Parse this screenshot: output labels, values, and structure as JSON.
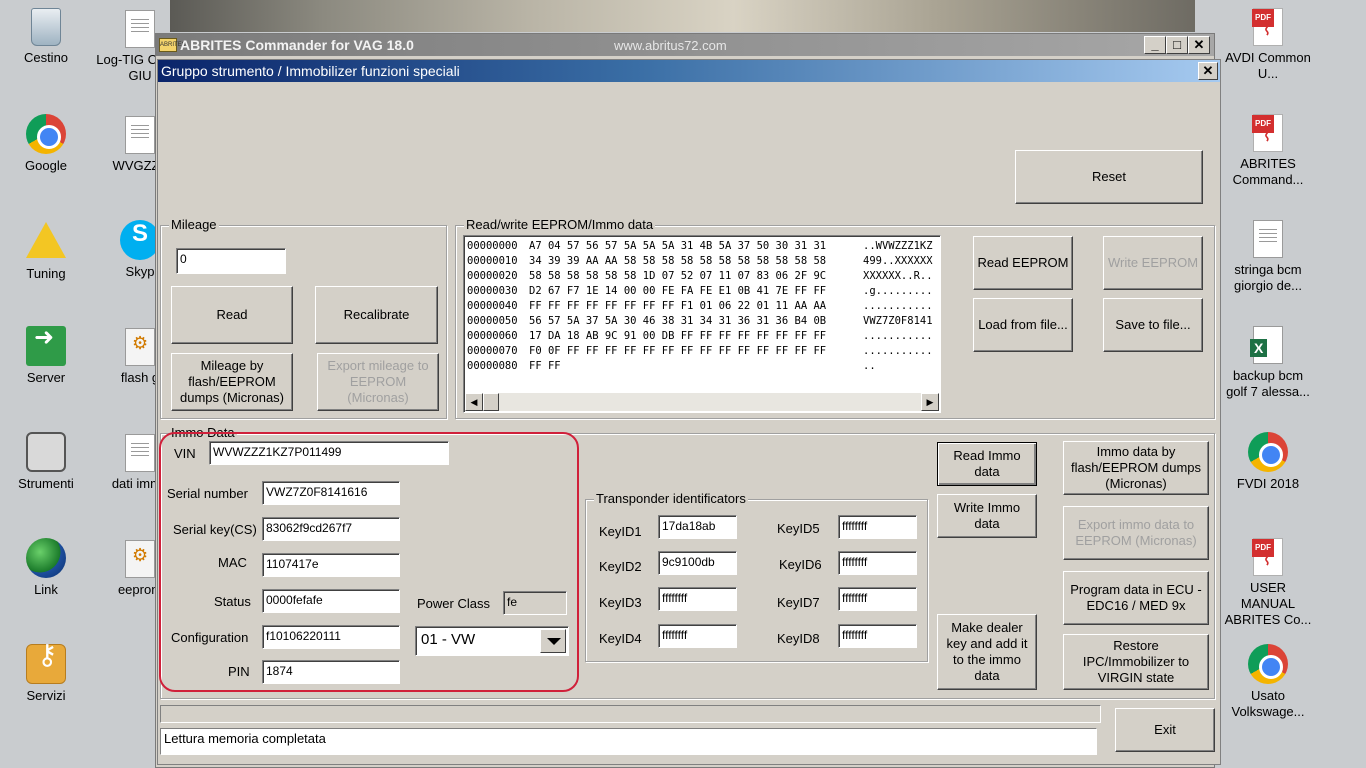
{
  "desktop": {
    "left_icons": [
      {
        "label": "Cestino",
        "icon": "recycle-bin-icon"
      },
      {
        "label": "Google",
        "icon": "chrome-icon"
      },
      {
        "label": "Tuning",
        "icon": "warning-icon"
      },
      {
        "label": "Server",
        "icon": "shortcut-icon"
      },
      {
        "label": "Strumenti",
        "icon": "toolbag-icon"
      },
      {
        "label": "Link",
        "icon": "globe-icon"
      },
      {
        "label": "Servizi",
        "icon": "key-icon"
      }
    ],
    "second_icons": [
      {
        "label": "Log-TIG CFGB GIU",
        "icon": "document-icon"
      },
      {
        "label": "WVGZZZ",
        "icon": "document-icon"
      },
      {
        "label": "Skyp",
        "icon": "skype-icon"
      },
      {
        "label": "flash g",
        "icon": "tool-file-icon"
      },
      {
        "label": "dati immo",
        "icon": "document-icon"
      },
      {
        "label": "eeprom",
        "icon": "tool-file-icon"
      }
    ],
    "right_icons": [
      {
        "label": "AVDI Common U...",
        "icon": "pdf-icon"
      },
      {
        "label": "ABRITES Command...",
        "icon": "pdf-icon"
      },
      {
        "label": "stringa bcm giorgio de...",
        "icon": "document-icon"
      },
      {
        "label": "backup bcm golf 7 alessa...",
        "icon": "excel-icon"
      },
      {
        "label": "FVDI 2018",
        "icon": "chrome-icon"
      },
      {
        "label": "USER MANUAL ABRITES Co...",
        "icon": "pdf-icon"
      },
      {
        "label": "Usato Volkswage...",
        "icon": "chrome-icon"
      }
    ]
  },
  "main_window": {
    "title": "ABRITES Commander for VAG 18.0",
    "url": "www.abritus72.com",
    "icon_text": "ABRITES",
    "controls": {
      "minimize": "_",
      "maximize": "□",
      "close": "✕"
    }
  },
  "dialog": {
    "title": "Gruppo strumento / Immobilizer funzioni speciali",
    "close": "✕",
    "reset_label": "Reset",
    "mileage": {
      "group_label": "Mileage",
      "value": "0",
      "read_label": "Read",
      "recalibrate_label": "Recalibrate",
      "by_flash_label": "Mileage by flash/EEPROM dumps (Micronas)",
      "export_label": "Export mileage to EEPROM (Micronas)"
    },
    "eeprom": {
      "group_label": "Read/write EEPROM/Immo data",
      "rows": [
        {
          "addr": "00000000",
          "bytes": "A7 04 57 56 57 5A 5A 5A 31 4B 5A 37 50 30 31 31",
          "ascii": "..WVWZZZ1KZ"
        },
        {
          "addr": "00000010",
          "bytes": "34 39 39 AA AA 58 58 58 58 58 58 58 58 58 58 58",
          "ascii": "499..XXXXXX"
        },
        {
          "addr": "00000020",
          "bytes": "58 58 58 58 58 58 1D 07 52 07 11 07 83 06 2F 9C",
          "ascii": "XXXXXX..R.."
        },
        {
          "addr": "00000030",
          "bytes": "D2 67 F7 1E 14 00 00 FE FA FE E1 0B 41 7E FF FF",
          "ascii": ".g........."
        },
        {
          "addr": "00000040",
          "bytes": "FF FF FF FF FF FF FF FF F1 01 06 22 01 11 AA AA",
          "ascii": "..........."
        },
        {
          "addr": "00000050",
          "bytes": "56 57 5A 37 5A 30 46 38 31 34 31 36 31 36 B4 0B",
          "ascii": "VWZ7Z0F8141"
        },
        {
          "addr": "00000060",
          "bytes": "17 DA 18 AB 9C 91 00 DB FF FF FF FF FF FF FF FF",
          "ascii": "..........."
        },
        {
          "addr": "00000070",
          "bytes": "F0 0F FF FF FF FF FF FF FF FF FF FF FF FF FF FF",
          "ascii": "..........."
        },
        {
          "addr": "00000080",
          "bytes": "FF FF",
          "ascii": ".."
        }
      ],
      "read_label": "Read EEPROM",
      "write_label": "Write EEPROM",
      "load_label": "Load from file...",
      "save_label": "Save to file..."
    },
    "immo": {
      "group_label": "Immo Data",
      "vin_label": "VIN",
      "vin": "WVWZZZ1KZ7P011499",
      "serial_label": "Serial number",
      "serial": "VWZ7Z0F8141616",
      "serial_key_label": "Serial key(CS)",
      "serial_key": "83062f9cd267f7",
      "mac_label": "MAC",
      "mac": "1107417e",
      "status_label": "Status",
      "status": "0000fefafe",
      "config_label": "Configuration",
      "config": "f10106220111",
      "pin_label": "PIN",
      "pin": "1874",
      "power_class_label": "Power Class",
      "power_class": "fe",
      "brand_selected": "01 - VW"
    },
    "transponder": {
      "group_label": "Transponder identificators",
      "keys": [
        {
          "label": "KeyID1",
          "value": "17da18ab"
        },
        {
          "label": "KeyID2",
          "value": "9c9100db"
        },
        {
          "label": "KeyID3",
          "value": "ffffffff"
        },
        {
          "label": "KeyID4",
          "value": "ffffffff"
        },
        {
          "label": "KeyID5",
          "value": "ffffffff"
        },
        {
          "label": "KeyID6",
          "value": "ffffffff"
        },
        {
          "label": "KeyID7",
          "value": "ffffffff"
        },
        {
          "label": "KeyID8",
          "value": "ffffffff"
        }
      ]
    },
    "actions": {
      "read_immo": "Read Immo data",
      "write_immo": "Write Immo data",
      "make_key": "Make dealer key and add it to the immo data",
      "immo_by_flash": "Immo data by flash/EEPROM dumps (Micronas)",
      "export_immo": "Export immo data to EEPROM (Micronas)",
      "program_ecu": "Program data in ECU - EDC16 / MED 9x",
      "restore": "Restore IPC/Immobilizer to VIRGIN state",
      "exit": "Exit"
    },
    "status_text": "Lettura memoria completata",
    "highlight_color": "#d0203a"
  }
}
